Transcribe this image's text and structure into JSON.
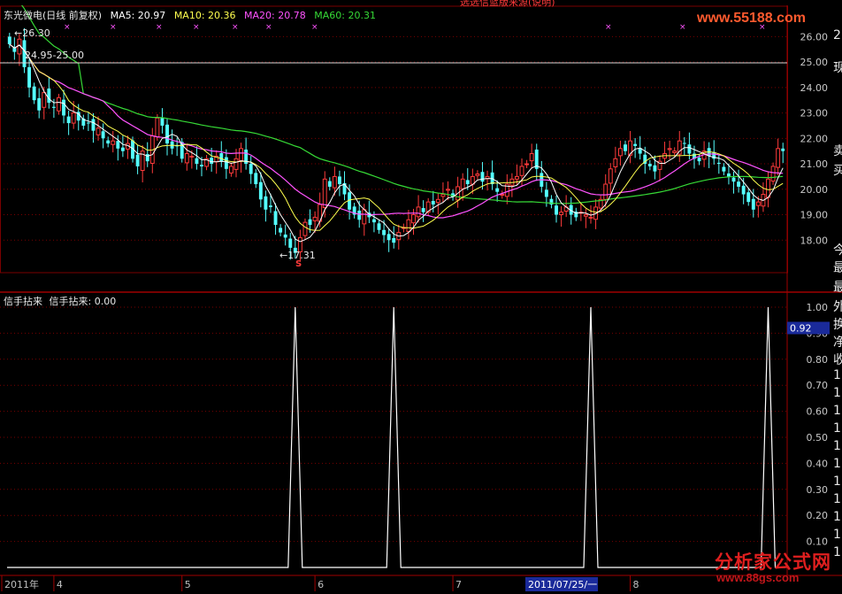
{
  "window": {
    "title_fragment": "选选信蓝版来源(说明)"
  },
  "header": {
    "stock_name": "东光微电(日线 前复权)",
    "ma5_label": "MA5: 20.97",
    "ma10_label": "MA10: 20.36",
    "ma20_label": "MA20: 20.78",
    "ma60_label": "MA60: 20.31"
  },
  "indicator": {
    "name": "信手拈来",
    "value_label": "信手拈来: 0.00",
    "current_value_badge": "0.92",
    "peaks_at_candle_index": [
      58,
      78,
      118,
      154
    ],
    "peak_value": 1.0
  },
  "annotations": {
    "high_price": "26.30",
    "band_label": "24.95-25.00",
    "low_price": "17.31",
    "signal_mark": "S"
  },
  "price_axis": {
    "min": 17.0,
    "max": 26.5,
    "ticks": [
      "26.00",
      "25.00",
      "24.00",
      "23.00",
      "22.00",
      "21.00",
      "20.00",
      "19.00",
      "18.00"
    ]
  },
  "indicator_axis": {
    "min": 0.0,
    "max": 1.0,
    "ticks": [
      "1.00",
      "0.90",
      "0.80",
      "0.70",
      "0.60",
      "0.50",
      "0.40",
      "0.30",
      "0.20",
      "0.10"
    ]
  },
  "time_axis": {
    "labels": [
      {
        "text": "2011年",
        "index": 0
      },
      {
        "text": "4",
        "index": 9
      },
      {
        "text": "5",
        "index": 35
      },
      {
        "text": "6",
        "index": 62
      },
      {
        "text": "7",
        "index": 90
      },
      {
        "text": "8",
        "index": 126
      }
    ],
    "cursor_date": "2011/07/25/一"
  },
  "right_panel_labels": [
    "2",
    "现",
    "卖",
    "买",
    "今",
    "最",
    "最",
    "外",
    "换",
    "净",
    "收",
    "1",
    "1",
    "1",
    "1",
    "1",
    "1",
    "1",
    "1",
    "1",
    "1",
    "1"
  ],
  "watermarks": {
    "top_site": "www.55188.com",
    "bottom_name": "分析家公式网",
    "bottom_url": "www.88gs.com"
  },
  "colors": {
    "up": "#ff3b3b",
    "down": "#54ffff",
    "ma5": "#ffffff",
    "ma10": "#ffff4f",
    "ma20": "#ff54ff",
    "ma60": "#36d936",
    "grid": "#7a0000",
    "axis_text": "#c8c8c8",
    "badge_bg": "#1a2a9a"
  },
  "chart_data": {
    "type": "candlestick",
    "closes": [
      25.7,
      25.4,
      25.9,
      24.8,
      24.0,
      23.5,
      23.1,
      23.8,
      23.4,
      23.2,
      23.6,
      22.9,
      22.6,
      23.0,
      22.7,
      22.5,
      22.6,
      22.3,
      22.4,
      22.0,
      21.8,
      21.9,
      21.6,
      21.5,
      21.8,
      21.2,
      20.9,
      21.5,
      21.1,
      22.1,
      22.8,
      22.5,
      21.8,
      21.6,
      21.7,
      21.2,
      21.4,
      21.3,
      21.0,
      20.9,
      21.2,
      21.0,
      21.3,
      21.1,
      20.8,
      20.9,
      21.2,
      21.6,
      21.0,
      20.6,
      20.2,
      19.6,
      19.2,
      19.3,
      18.6,
      18.3,
      18.1,
      17.7,
      17.5,
      18.1,
      18.7,
      18.6,
      18.9,
      19.4,
      20.4,
      20.1,
      20.5,
      20.2,
      19.8,
      19.2,
      19.0,
      18.8,
      19.2,
      18.9,
      18.7,
      18.4,
      18.2,
      18.0,
      17.9,
      18.3,
      18.5,
      18.8,
      19.0,
      19.3,
      19.1,
      19.5,
      19.4,
      19.6,
      19.8,
      20.0,
      19.7,
      20.1,
      20.4,
      20.2,
      20.5,
      20.6,
      20.3,
      20.5,
      20.2,
      19.9,
      19.8,
      20.2,
      20.4,
      20.5,
      20.9,
      21.0,
      21.4,
      20.8,
      20.1,
      19.7,
      19.4,
      19.0,
      19.1,
      19.3,
      19.0,
      18.9,
      19.1,
      19.0,
      18.9,
      19.3,
      19.6,
      20.2,
      20.8,
      21.2,
      21.6,
      21.5,
      21.9,
      21.7,
      21.4,
      21.0,
      20.9,
      20.7,
      21.1,
      21.4,
      21.6,
      21.5,
      21.9,
      21.8,
      21.4,
      21.2,
      21.1,
      21.5,
      21.3,
      21.2,
      21.0,
      20.7,
      20.5,
      20.3,
      20.1,
      19.8,
      19.5,
      19.2,
      19.5,
      19.8,
      20.4,
      20.9,
      21.6,
      21.5
    ],
    "ma5_last": 20.97,
    "ma10_last": 20.36,
    "ma20_last": 20.78,
    "ma60_last": 20.31
  }
}
